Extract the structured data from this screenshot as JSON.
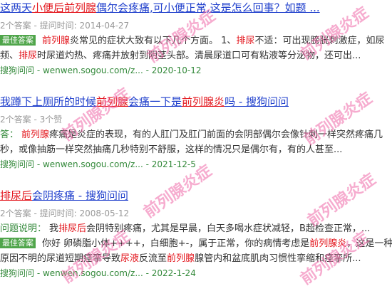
{
  "colors": {
    "link": "#1f3fcc",
    "highlight": "#e3161d",
    "text": "#333333",
    "meta": "#999999",
    "source": "#33893a",
    "badge_bg": "#4fa54a",
    "badge_text": "#ffffff",
    "watermark": "#f06aa8",
    "page_bg": "#ffffff"
  },
  "watermark": {
    "text": "前列腺炎症"
  },
  "results": [
    {
      "title": [
        {
          "text": "这两天",
          "highlight": false
        },
        {
          "text": "小便后前列腺",
          "highlight": true
        },
        {
          "text": "偶尔会疼痛,可小便正常,这是怎么回事？如题 ...",
          "highlight": false
        }
      ],
      "meta": "2个答案 - 提问时间: 2014-04-27",
      "answer": {
        "badge": "最佳答案",
        "lines": [
          [
            {
              "text": "前列腺",
              "highlight": true
            },
            {
              "text": "炎常见的症状大致有以下几个方面。 1、",
              "highlight": false
            },
            {
              "text": "排尿",
              "highlight": true
            },
            {
              "text": "不适：可出现膀胱刺激症，如尿",
              "highlight": false
            }
          ],
          [
            {
              "text": "频、",
              "highlight": false
            },
            {
              "text": "排尿",
              "highlight": true
            },
            {
              "text": "时尿道灼热、疼痛并放射到阴茎头部。清晨尿道口可有粘液等分泌物，还可出...",
              "highlight": false
            }
          ]
        ]
      },
      "source": "搜狗问问 - wenwen.sogou.com/z... - 2020-10-12"
    },
    {
      "title": [
        {
          "text": "我蹲下上厕所的时候",
          "highlight": false
        },
        {
          "text": "前列腺",
          "highlight": true
        },
        {
          "text": "会痛一下是",
          "highlight": false
        },
        {
          "text": "前列腺炎",
          "highlight": true
        },
        {
          "text": "吗 - 搜狗问问",
          "highlight": false
        }
      ],
      "meta": "2个答案 - 3个赞",
      "answer": {
        "prefix": "答：",
        "lines": [
          [
            {
              "text": "前列腺",
              "highlight": true
            },
            {
              "text": "疼痛是炎症的表现，有的人肛门及肛门前面的会阴部偶尔会像针刺一样突然疼痛几",
              "highlight": false
            }
          ],
          [
            {
              "text": "秒，或像抽筋一样突然抽痛几秒特别不舒服，这样的情况只是偶尔有，有的人甚至...",
              "highlight": false
            }
          ]
        ]
      },
      "source": "搜狗问问 - wenwen.sogou.com/z... - 2021-12-5"
    },
    {
      "title": [
        {
          "text": "排尿后",
          "highlight": true
        },
        {
          "text": "会阴疼痛 - 搜狗问问",
          "highlight": false
        }
      ],
      "meta": "2个答案 - 提问时间: 2008-05-12",
      "question": {
        "prefix": "问题说明：",
        "segments": [
          {
            "text": "我",
            "highlight": false
          },
          {
            "text": "排尿后",
            "highlight": true
          },
          {
            "text": "会阴特别疼痛，尤其是早晨，白天多喝水症状减轻，B超检查正常，...",
            "highlight": false
          }
        ]
      },
      "answer": {
        "badge": "最佳答案",
        "lines": [
          [
            {
              "text": "你好 卵磷脂小体++++，白细胞+-，属于正常，你的病情考虑是",
              "highlight": false
            },
            {
              "text": "前列腺炎",
              "highlight": true
            },
            {
              "text": "，这是一种",
              "highlight": false
            }
          ],
          [
            {
              "text": "原因不明的尿道短期痉挛导致",
              "highlight": false
            },
            {
              "text": "尿液",
              "highlight": true
            },
            {
              "text": "反流至",
              "highlight": false
            },
            {
              "text": "前列腺",
              "highlight": true
            },
            {
              "text": "腺管内和盆底肌肉习惯性挛缩和痉挛所...",
              "highlight": false
            }
          ]
        ]
      },
      "source": "搜狗问问 - wenwen.sogou.com/z... - 2022-1-24"
    }
  ]
}
